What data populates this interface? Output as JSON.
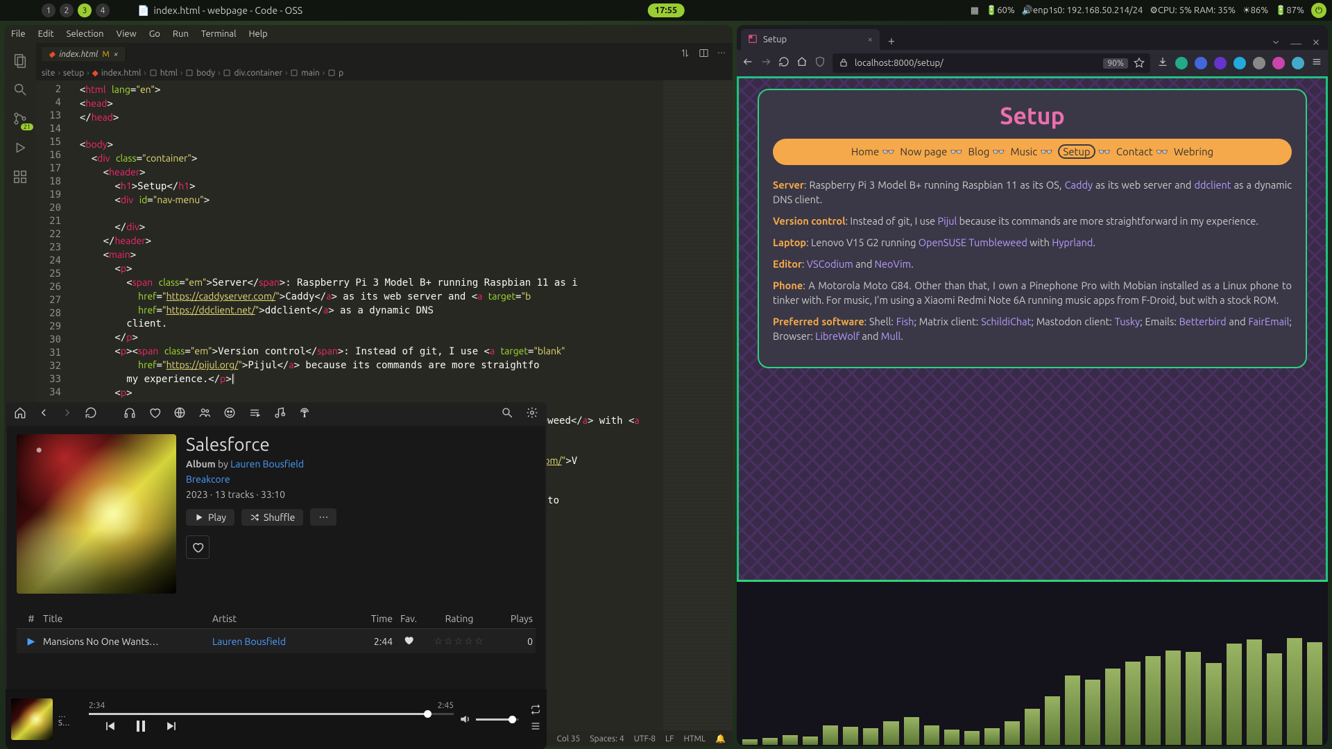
{
  "topbar": {
    "workspaces": [
      "1",
      "2",
      "3",
      "4"
    ],
    "active_ws": "3",
    "win_title": "index.html - webpage - Code - OSS",
    "clock": "17:55",
    "batt1": "60%",
    "iface": "enp1s0: 192.168.50.214/24",
    "cpu": "CPU: 5% RAM: 35%",
    "brightness": "86%",
    "batt2": "87%"
  },
  "vscode": {
    "menu": [
      "File",
      "Edit",
      "Selection",
      "View",
      "Go",
      "Run",
      "Terminal",
      "Help"
    ],
    "tab_name": "index.html",
    "tab_modified": "M",
    "crumbs": [
      "site",
      "setup",
      "index.html",
      "html",
      "body",
      "div.container",
      "main",
      "p"
    ],
    "status": [
      "Col 35",
      "Spaces: 4",
      "UTF-8",
      "LF",
      "HTML"
    ],
    "gutter_lines": [
      "2",
      "4",
      "13",
      "14",
      "15",
      "16",
      "17",
      "18",
      "19",
      "20",
      "21",
      "22",
      "23",
      "24",
      "25",
      "26",
      "27",
      "28",
      "29",
      "30",
      "31",
      "32",
      "33",
      "34"
    ]
  },
  "music": {
    "title": "Salesforce",
    "type_label": "Album",
    "by_label": "by",
    "artist": "Lauren Bousfield",
    "genre": "Breakcore",
    "meta": "2023 · 13 tracks · 33:10",
    "play_label": "Play",
    "shuffle_label": "Shuffle",
    "cols": {
      "num": "#",
      "title": "Title",
      "artist": "Artist",
      "time": "Time",
      "fav": "Fav.",
      "rating": "Rating",
      "plays": "Plays"
    },
    "track1": {
      "title": "Mansions No One Wants…",
      "artist": "Lauren Bousfield",
      "time": "2:44",
      "plays": "0"
    },
    "now": {
      "line1": "…",
      "line2": "S…"
    },
    "pos": "2:34",
    "dur": "2:45"
  },
  "browser": {
    "tab_title": "Setup",
    "url": "localhost:8000/setup/",
    "zoom": "90%",
    "page_title": "Setup",
    "nav": [
      "Home",
      "Now page",
      "Blog",
      "Music",
      "Setup",
      "Contact",
      "Webring"
    ],
    "p_server_label": "Server",
    "p_server_1": ": Raspberry Pi 3 Model B+ running Raspbian 11 as its OS, ",
    "p_server_caddy": "Caddy",
    "p_server_2": " as its web server and ",
    "p_server_dd": "ddclient",
    "p_server_3": " as a dynamic DNS client.",
    "p_vc_label": "Version control",
    "p_vc_1": ": Instead of git, I use ",
    "p_vc_pijul": "Pijul",
    "p_vc_2": " because its commands are more straightforward in my experience.",
    "p_lap_label": "Laptop",
    "p_lap_1": ": Lenovo V15 G2 running ",
    "p_lap_os": "OpenSUSE Tumbleweed",
    "p_lap_2": " with ",
    "p_lap_hypr": "Hyprland",
    "p_lap_3": ".",
    "p_ed_label": "Editor",
    "p_ed_1": ": ",
    "p_ed_v": "VSCodium",
    "p_ed_2": " and ",
    "p_ed_n": "NeoVim",
    "p_ed_3": ".",
    "p_ph_label": "Phone",
    "p_ph_1": ": A Motorola Moto G84. Other than that, I own a Pinephone Pro with Mobian installed as a Linux phone to tinker with. For music, I'm using a Xiaomi Redmi Note 6A running music apps from F-Droid, but with a stock ROM.",
    "p_pref_label": "Preferred software",
    "p_pref_1": ": Shell: ",
    "p_fish": "Fish",
    "p_pref_2": "; Matrix client: ",
    "p_schildi": "SchildiChat",
    "p_pref_3": "; Mastodon client: ",
    "p_tusky": "Tusky",
    "p_pref_4": "; Emails: ",
    "p_better": "Betterbird",
    "p_pref_5": " and ",
    "p_fair": "FairEmail",
    "p_pref_6": "; Browser: ",
    "p_libre": "LibreWolf",
    "p_pref_7": " and ",
    "p_mull": "Mull",
    "p_pref_8": "."
  },
  "viz_heights": [
    8,
    10,
    14,
    12,
    28,
    26,
    24,
    34,
    40,
    28,
    22,
    20,
    24,
    34,
    52,
    70,
    100,
    94,
    110,
    120,
    128,
    136,
    134,
    118,
    146,
    152,
    132,
    154,
    148
  ]
}
